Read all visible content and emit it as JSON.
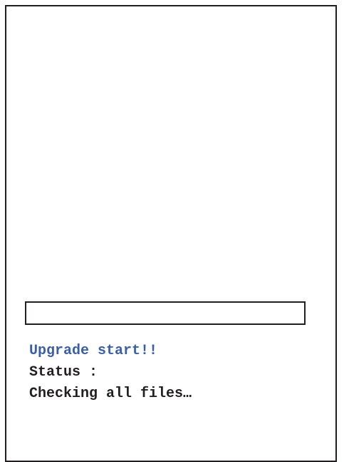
{
  "upgrade": {
    "title": "Upgrade start!!",
    "status_label": "Status :",
    "status_text": "Checking all files…",
    "progress_fraction": 0
  },
  "colors": {
    "title": "#3b5ea8",
    "text": "#231f20",
    "border": "#231f20",
    "background": "#ffffff"
  }
}
